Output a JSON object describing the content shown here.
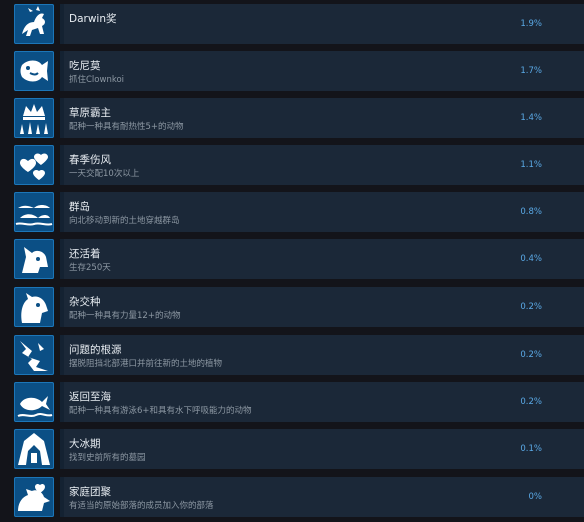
{
  "achievements": [
    {
      "title": "Darwin奖",
      "desc": "",
      "pct": "1.9%",
      "icon": "running-creature-icon"
    },
    {
      "title": "吃尼莫",
      "desc": "抓住Clownkoi",
      "pct": "1.7%",
      "icon": "fish-icon"
    },
    {
      "title": "草原霸主",
      "desc": "配种一种具有耐热性5+的动物",
      "pct": "1.4%",
      "icon": "crown-icon"
    },
    {
      "title": "春季伤风",
      "desc": "一天交配10次以上",
      "pct": "1.1%",
      "icon": "hearts-icon"
    },
    {
      "title": "群岛",
      "desc": "向北移动到新的土地穿越群岛",
      "pct": "0.8%",
      "icon": "islands-icon"
    },
    {
      "title": "还活着",
      "desc": "生存250天",
      "pct": "0.4%",
      "icon": "beast-head-icon"
    },
    {
      "title": "杂交种",
      "desc": "配种一种具有力量12+的动物",
      "pct": "0.2%",
      "icon": "bear-icon"
    },
    {
      "title": "问题的根源",
      "desc": "摆脱阻挡北部港口并前往新的土地的植物",
      "pct": "0.2%",
      "icon": "roots-icon"
    },
    {
      "title": "返回至海",
      "desc": "配种一种具有游泳6+和具有水下呼吸能力的动物",
      "pct": "0.2%",
      "icon": "whale-icon"
    },
    {
      "title": "大冰期",
      "desc": "找到史前所有的墓园",
      "pct": "0.1%",
      "icon": "ice-cave-icon"
    },
    {
      "title": "家庭团聚",
      "desc": "有适当的原始部落的成员加入你的部落",
      "pct": "0%",
      "icon": "family-icon"
    }
  ]
}
